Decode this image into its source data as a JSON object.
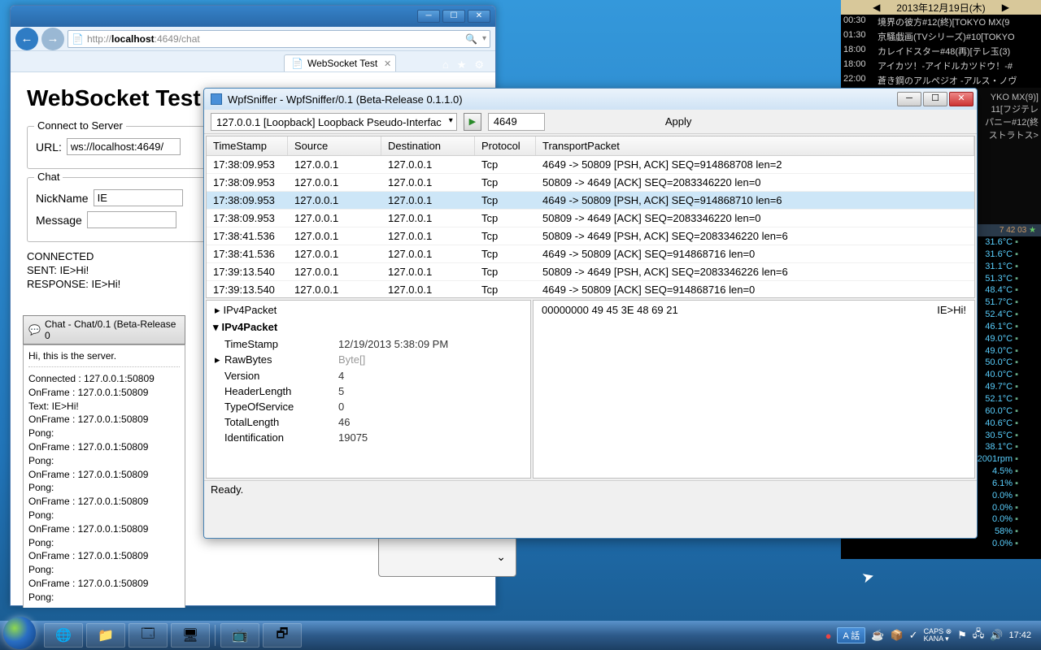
{
  "ie": {
    "url_prefix": "http://",
    "url_host": "localhost",
    "url_port": ":4649/chat",
    "search_icon": "🔍",
    "tab_title": "WebSocket Test",
    "title_icons": {
      "home": "⌂",
      "fav": "★",
      "gear": "⚙"
    },
    "page": {
      "h1": "WebSocket Test",
      "connect_title": "Connect to Server",
      "url_label": "URL:",
      "url_value": "ws://localhost:4649/",
      "chat_title": "Chat",
      "nick_label": "NickName",
      "nick_value": "IE",
      "msg_label": "Message",
      "msg_value": "",
      "status": [
        "CONNECTED",
        "SENT: IE>Hi!",
        "RESPONSE: IE>Hi!"
      ]
    }
  },
  "chat": {
    "title": "Chat - Chat/0.1 (Beta-Release 0",
    "greeting": "Hi, this is the server.",
    "log": [
      "Connected : 127.0.0.1:50809",
      "OnFrame : 127.0.0.1:50809",
      "Text: IE>Hi!",
      "OnFrame : 127.0.0.1:50809",
      "Pong:",
      "OnFrame : 127.0.0.1:50809",
      "Pong:",
      "OnFrame : 127.0.0.1:50809",
      "Pong:",
      "OnFrame : 127.0.0.1:50809",
      "Pong:",
      "OnFrame : 127.0.0.1:50809",
      "Pong:",
      "OnFrame : 127.0.0.1:50809",
      "Pong:",
      "OnFrame : 127.0.0.1:50809",
      "Pong:"
    ]
  },
  "sniffer": {
    "title": "WpfSniffer - WpfSniffer/0.1 (Beta-Release 0.1.1.0)",
    "interface": "127.0.0.1 [Loopback] Loopback Pseudo-Interfac",
    "port": "4649",
    "apply": "Apply",
    "cols": {
      "ts": "TimeStamp",
      "src": "Source",
      "dst": "Destination",
      "proto": "Protocol",
      "pkt": "TransportPacket"
    },
    "rows": [
      {
        "ts": "17:38:09.953",
        "src": "127.0.0.1",
        "dst": "127.0.0.1",
        "proto": "Tcp",
        "pkt": "4649 -> 50809  [PSH, ACK]  SEQ=914868708  len=2",
        "sel": false
      },
      {
        "ts": "17:38:09.953",
        "src": "127.0.0.1",
        "dst": "127.0.0.1",
        "proto": "Tcp",
        "pkt": "50809 -> 4649  [ACK]  SEQ=2083346220  len=0",
        "sel": false
      },
      {
        "ts": "17:38:09.953",
        "src": "127.0.0.1",
        "dst": "127.0.0.1",
        "proto": "Tcp",
        "pkt": "4649 -> 50809  [PSH, ACK]  SEQ=914868710  len=6",
        "sel": true
      },
      {
        "ts": "17:38:09.953",
        "src": "127.0.0.1",
        "dst": "127.0.0.1",
        "proto": "Tcp",
        "pkt": "50809 -> 4649  [ACK]  SEQ=2083346220  len=0",
        "sel": false
      },
      {
        "ts": "17:38:41.536",
        "src": "127.0.0.1",
        "dst": "127.0.0.1",
        "proto": "Tcp",
        "pkt": "50809 -> 4649  [PSH, ACK]  SEQ=2083346220  len=6",
        "sel": false
      },
      {
        "ts": "17:38:41.536",
        "src": "127.0.0.1",
        "dst": "127.0.0.1",
        "proto": "Tcp",
        "pkt": "4649 -> 50809  [ACK]  SEQ=914868716  len=0",
        "sel": false
      },
      {
        "ts": "17:39:13.540",
        "src": "127.0.0.1",
        "dst": "127.0.0.1",
        "proto": "Tcp",
        "pkt": "50809 -> 4649  [PSH, ACK]  SEQ=2083346226  len=6",
        "sel": false
      },
      {
        "ts": "17:39:13.540",
        "src": "127.0.0.1",
        "dst": "127.0.0.1",
        "proto": "Tcp",
        "pkt": "4649 -> 50809  [ACK]  SEQ=914868716  len=0",
        "sel": false
      }
    ],
    "detail_hdr1": "IPv4Packet",
    "detail_hdr2": "IPv4Packet",
    "details": [
      {
        "k": "TimeStamp",
        "v": "12/19/2013 5:38:09 PM"
      },
      {
        "k": "RawBytes",
        "v": "Byte[]"
      },
      {
        "k": "Version",
        "v": "4"
      },
      {
        "k": "HeaderLength",
        "v": "5"
      },
      {
        "k": "TypeOfService",
        "v": "0"
      },
      {
        "k": "TotalLength",
        "v": "46"
      },
      {
        "k": "Identification",
        "v": "19075"
      }
    ],
    "hex": "00000000  49 45 3E 48 69 21",
    "hex_ascii": "IE>Hi!",
    "status": "Ready."
  },
  "sidebar": {
    "date": "2013年12月19日(木)",
    "arrows": {
      "l": "◀",
      "r": "▶"
    },
    "sched": [
      {
        "t": "00:30",
        "n": "境界の彼方#12(終)[TOKYO MX(9"
      },
      {
        "t": "01:30",
        "n": "京騒戯画(TVシリーズ)#10[TOKYO"
      },
      {
        "t": "18:00",
        "n": "カレイドスター#48(再)[テレ玉(3)"
      },
      {
        "t": "18:00",
        "n": "アイカツ！-アイドルカツドウ！-#"
      },
      {
        "t": "22:00",
        "n": "蒼き鋼のアルペジオ -アルス・ノヴ"
      }
    ],
    "sched2": [
      "YKO MX(9)]",
      "11[フジテレ",
      "パニー#12(終",
      "ストラトス>"
    ],
    "small_stat": "7 42 03",
    "temps": [
      "31.6°C",
      "31.6°C",
      "31.1°C",
      "51.3°C",
      "48.4°C",
      "51.7°C",
      "52.4°C",
      "46.1°C",
      "49.0°C",
      "49.0°C",
      "50.0°C",
      "40.0°C",
      "49.7°C",
      "52.1°C",
      "60.0°C",
      "40.6°C",
      "30.5°C",
      "38.1°C",
      "2001rpm",
      "4.5%",
      "6.1%",
      "0.0%",
      "0.0%",
      "0.0%",
      "58%",
      "0.0%"
    ]
  },
  "taskbar": {
    "lang": "A 話",
    "ime": "KANA",
    "caps": "CAPS",
    "clock": "17:42"
  }
}
